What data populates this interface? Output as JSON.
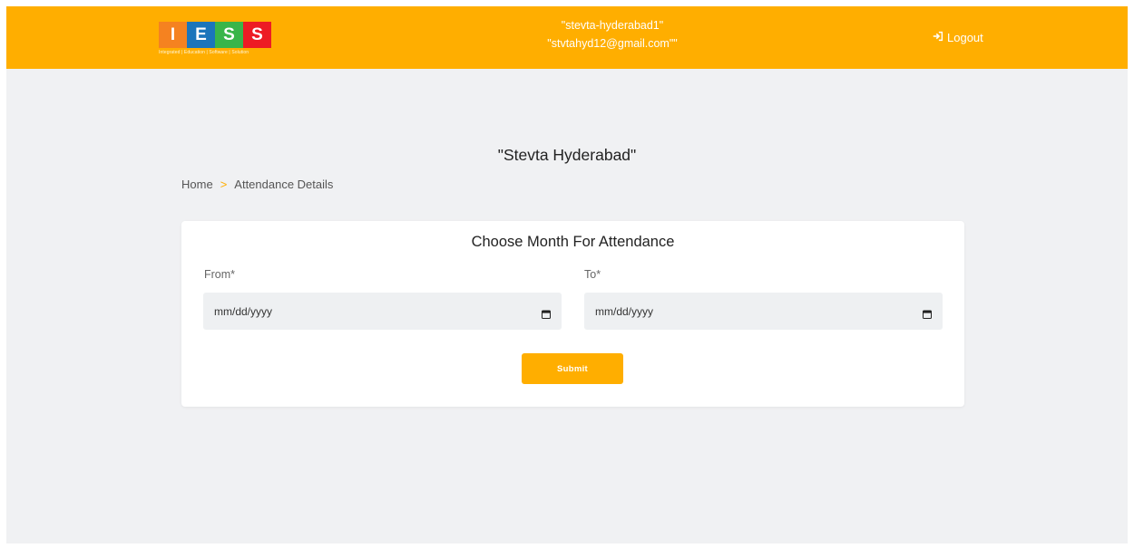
{
  "header": {
    "logo": {
      "letters": [
        "I",
        "E",
        "S",
        "S"
      ],
      "tile_colors": [
        "#f58220",
        "#1b75bb",
        "#39b54a",
        "#ed1c24"
      ],
      "tagline": "Integrated | Education | Software | Solution"
    },
    "user": {
      "username": "\"stevta-hyderabad1\"",
      "email": "\"stvtahyd12@gmail.com\"\""
    },
    "logout_label": "Logout",
    "logout_icon": "sign-out-icon",
    "accent_color": "#ffae00"
  },
  "page": {
    "org_title": "\"Stevta Hyderabad\"",
    "breadcrumb": {
      "home": "Home",
      "separator": ">",
      "current": "Attendance Details"
    }
  },
  "form": {
    "title": "Choose Month For Attendance",
    "from": {
      "label": "From*",
      "placeholder": "mm/dd/yyyy",
      "icon": "calendar-icon"
    },
    "to": {
      "label": "To*",
      "placeholder": "mm/dd/yyyy",
      "icon": "calendar-icon"
    },
    "submit_label": "Submit"
  }
}
